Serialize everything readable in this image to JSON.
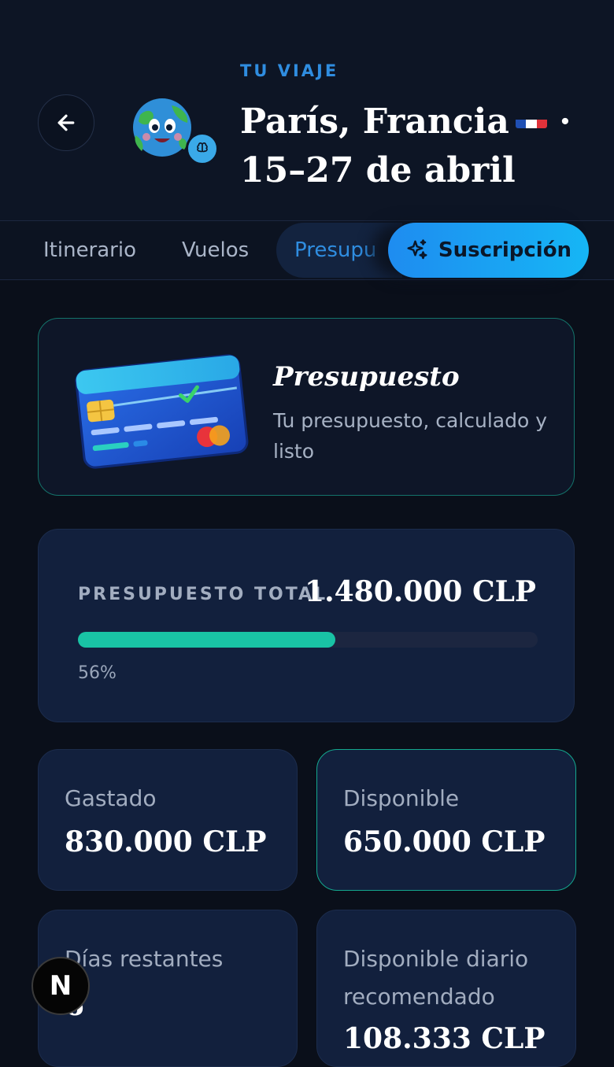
{
  "header": {
    "eyebrow": "TU VIAJE",
    "title_line1": "París, Francia",
    "title_line2": "·",
    "title_line3": "15–27 de abril",
    "flag_colors": [
      "#1f4fb3",
      "#ffffff",
      "#e0323a"
    ]
  },
  "icons": {
    "back": "arrow-left-icon",
    "avatar": "globe-mascot-icon",
    "sparkle": "sparkles-icon",
    "card": "credit-card-icon"
  },
  "tabs": [
    {
      "label": "Itinerario",
      "active": false
    },
    {
      "label": "Vuelos",
      "active": false
    },
    {
      "label": "Presupu",
      "active": true
    }
  ],
  "subscription_button": {
    "label": "Suscripción"
  },
  "hero": {
    "title": "Presupuesto",
    "description": "Tu presupuesto, calculado y listo"
  },
  "total": {
    "label": "PRESUPUESTO TOTAL",
    "value": "1.480.000 CLP",
    "progress_percent": 56,
    "progress_label": "56%",
    "progress_color": "#19c3a5"
  },
  "stats": [
    {
      "label": "Gastado",
      "value": "830.000 CLP"
    },
    {
      "label": "Disponible",
      "value": "650.000 CLP"
    },
    {
      "label": "Días restantes",
      "value": "6"
    },
    {
      "label": "Disponible diario recomendado",
      "value": "108.333 CLP"
    }
  ],
  "fab": {
    "label": "N"
  }
}
